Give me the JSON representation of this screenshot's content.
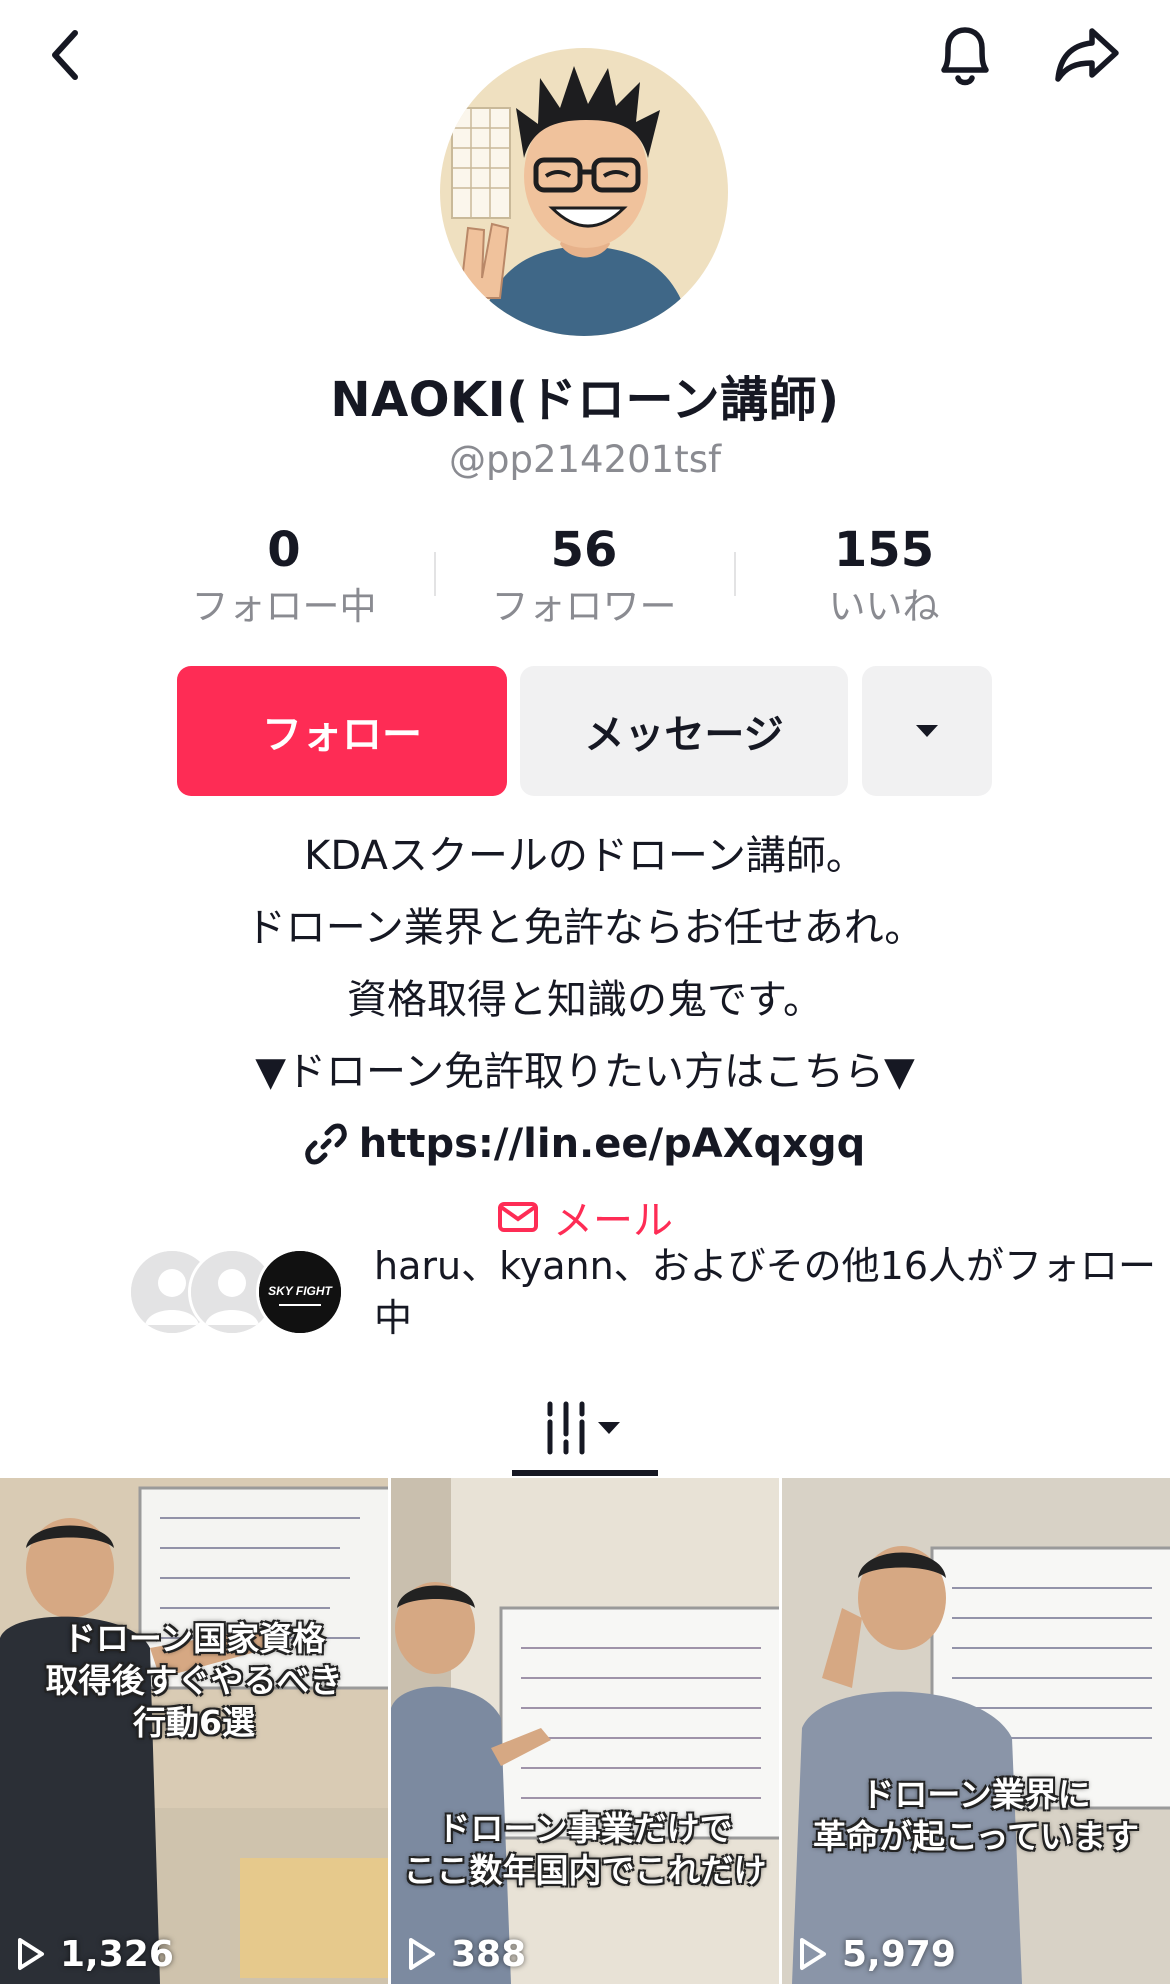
{
  "profile": {
    "display_name": "NAOKI(ドローン講師)",
    "handle": "@pp214201tsf"
  },
  "stats": [
    {
      "value": "0",
      "label": "フォロー中"
    },
    {
      "value": "56",
      "label": "フォロワー"
    },
    {
      "value": "155",
      "label": "いいね"
    }
  ],
  "actions": {
    "follow_label": "フォロー",
    "message_label": "メッセージ"
  },
  "bio": {
    "lines": [
      "KDAスクールのドローン講師。",
      "ドローン業界と免許ならお任せあれ。",
      "資格取得と知識の鬼です。",
      "▼ドローン免許取りたい方はこちら▼"
    ],
    "link": "https://lin.ee/pAXqxgq",
    "mail_label": "メール"
  },
  "mutual": {
    "text": "haru、kyann、およびその他16人がフォロー中",
    "badge_text": "SKY FIGHT"
  },
  "colors": {
    "accent": "#fe2c55",
    "text": "#161823",
    "muted": "#8a8b91"
  },
  "videos": [
    {
      "caption": [
        "ドローン国家資格",
        "取得後すぐやるべき",
        "行動6選"
      ],
      "views": "1,326"
    },
    {
      "caption": [
        "ドローン事業だけで",
        "ここ数年国内でこれだけ"
      ],
      "views": "388"
    },
    {
      "caption": [
        "ドローン業界に",
        "革命が起こっています"
      ],
      "views": "5,979"
    }
  ]
}
